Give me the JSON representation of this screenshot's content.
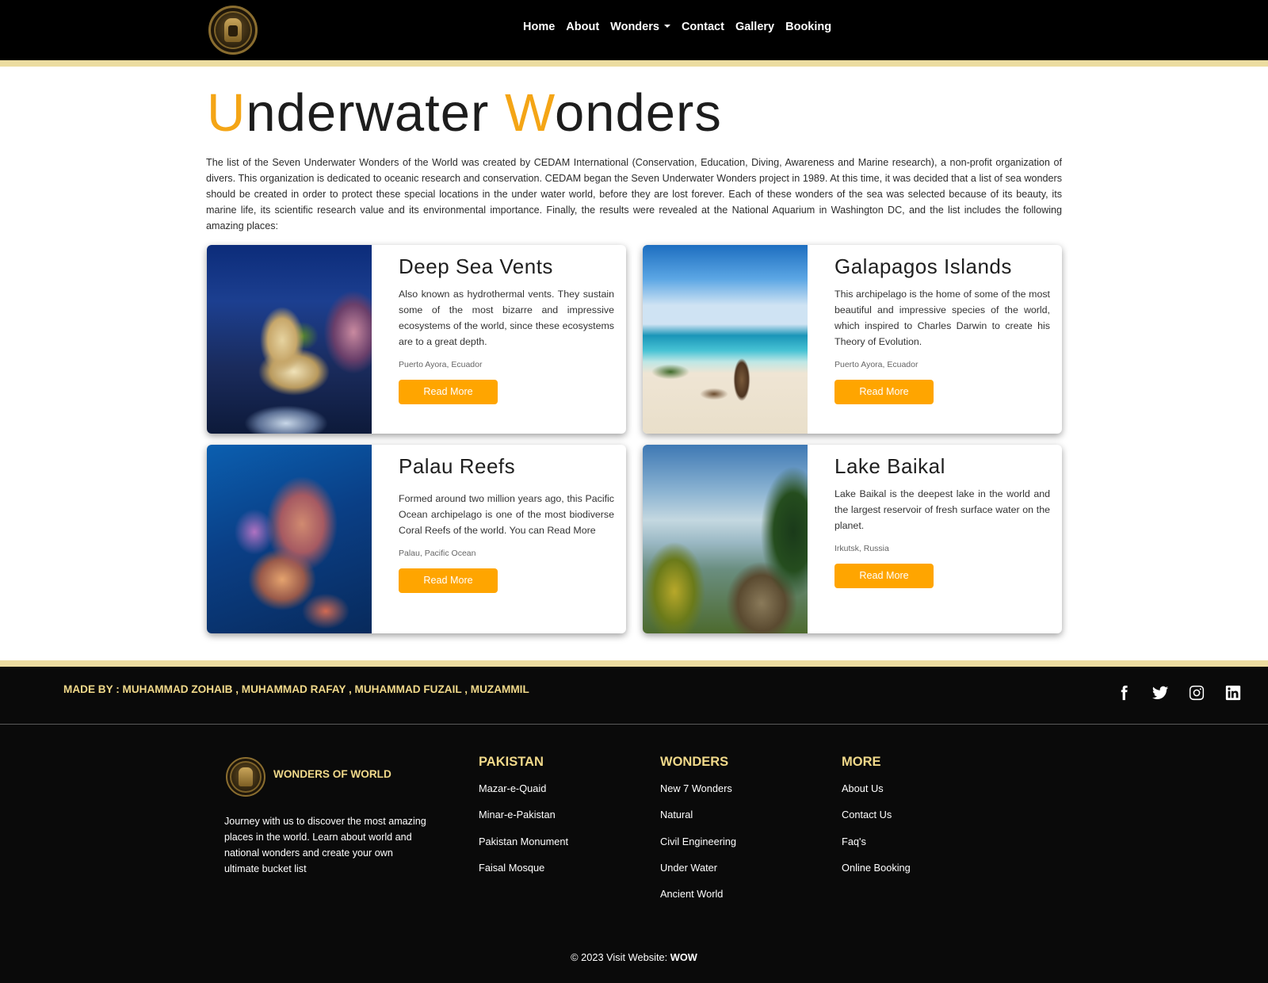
{
  "nav": {
    "logo_alt": "Wonders of World",
    "links": [
      "Home",
      "About",
      "Wonders",
      "Contact",
      "Gallery",
      "Booking"
    ]
  },
  "hero": {
    "title_first_letter": "U",
    "title_first_rest": "nderwater",
    "title_second_letter": "W",
    "title_second_rest": "onders",
    "intro": "The list of the Seven Underwater Wonders of the World was created by CEDAM International (Conservation, Education, Diving, Awareness and Marine research), a non-profit organization of divers. This organization is dedicated to oceanic research and conservation. CEDAM began the Seven Underwater Wonders project in 1989. At this time, it was decided that a list of sea wonders should be created in order to protect these special locations in the under water world, before they are lost forever. Each of these wonders of the sea was selected because of its beauty, its marine life, its scientific research value and its environmental importance. Finally, the results were revealed at the National Aquarium in Washington DC, and the list includes the following amazing places:"
  },
  "cards": [
    {
      "title": "Deep Sea Vents",
      "description": "Also known as hydrothermal vents. They sustain some of the most bizarre and impressive ecosystems of the world, since these ecosystems are to a great depth.",
      "location": "Puerto Ayora, Ecuador",
      "button": "Read More"
    },
    {
      "title": "Galapagos Islands",
      "description": "This archipelago is the home of some of the most beautiful and impressive species of the world, which inspired to Charles Darwin to create his Theory of Evolution.",
      "location": "Puerto Ayora, Ecuador",
      "button": "Read More"
    },
    {
      "title": "Palau Reefs",
      "description": "Formed around two million years ago, this Pacific Ocean archipelago is one of the most biodiverse Coral Reefs of the world. You can Read More",
      "location": "Palau, Pacific Ocean",
      "button": "Read More"
    },
    {
      "title": "Lake Baikal",
      "description": "Lake Baikal is the deepest lake in the world and the largest reservoir of fresh surface water on the planet.",
      "location": "Irkutsk, Russia",
      "button": "Read More"
    }
  ],
  "footer": {
    "made_by": "MADE BY : MUHAMMAD ZOHAIB , MUHAMMAD RAFAY , MUHAMMAD FUZAIL , MUZAMMIL",
    "socials": [
      "facebook-icon",
      "twitter-icon",
      "instagram-icon",
      "linkedin-icon"
    ],
    "brand": "WONDERS OF WORLD",
    "about": "Journey with us to discover the most amazing places in the world. Learn about world and national wonders and create your own ultimate bucket list",
    "columns": [
      {
        "heading": "PAKISTAN",
        "links": [
          "Mazar-e-Quaid",
          "Minar-e-Pakistan",
          "Pakistan Monument",
          "Faisal Mosque"
        ]
      },
      {
        "heading": "WONDERS",
        "links": [
          "New 7 Wonders",
          "Natural",
          "Civil Engineering",
          "Under Water",
          "Ancient World"
        ]
      },
      {
        "heading": "MORE",
        "links": [
          "About Us",
          "Contact Us",
          "Faq's",
          "Online Booking"
        ]
      }
    ],
    "copyright_prefix": "© 2023 Visit Website: ",
    "copyright_brand": "WOW"
  },
  "colors": {
    "accent": "#ffa500",
    "title_accent": "#f4a516",
    "gold": "#f1d98a",
    "stripe": "#ecdca0",
    "nav_bg": "#000000",
    "footer_bg": "#0a0a0a"
  }
}
